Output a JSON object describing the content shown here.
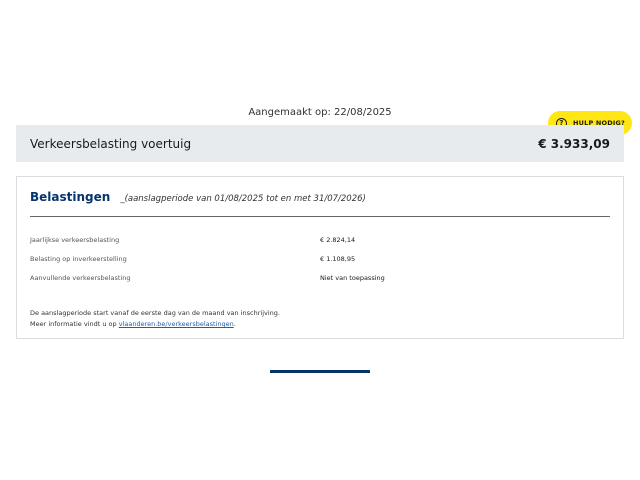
{
  "created_label": "Aangemaakt op: 22/08/2025",
  "help": {
    "label": "HULP NODIG?",
    "icon": "question-circle-icon"
  },
  "header": {
    "title": "Verkeersbelasting voertuig",
    "amount": "€ 3.933,09"
  },
  "taxes": {
    "heading": "Belastingen",
    "period": "_(aanslagperiode van 01/08/2025 tot en met 31/07/2026)",
    "rows": [
      {
        "label": "Jaarlijkse verkeersbelasting",
        "value": "€ 2.824,14"
      },
      {
        "label": "Belasting op inverkeerstelling",
        "value": "€ 1.108,95"
      },
      {
        "label": "Aanvullende verkeersbelasting",
        "value": "Niet van toepassing"
      }
    ],
    "note_line1": "De aanslagperiode start vanaf de eerste dag van de maand van inschrijving.",
    "note_line2_prefix": "Meer informatie vindt u op ",
    "note_link": "vlaanderen.be/verkeersbelastingen",
    "note_line2_suffix": "."
  },
  "colors": {
    "accent_yellow": "#ffe615",
    "header_bg": "#e8ebee",
    "heading_blue": "#05356b",
    "link_blue": "#1f5fa8"
  }
}
